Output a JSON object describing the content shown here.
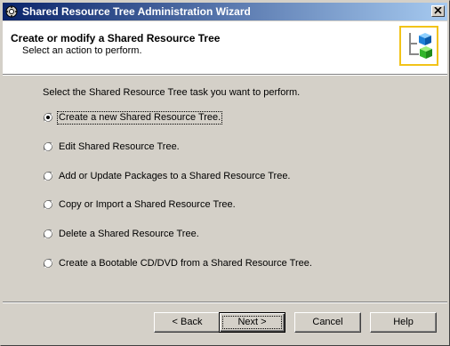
{
  "window": {
    "title": "Shared Resource Tree Administration Wizard",
    "close_label": "x"
  },
  "header": {
    "title": "Create or modify a Shared Resource Tree",
    "subtitle": "Select an action to perform."
  },
  "main": {
    "instruction": "Select the Shared Resource Tree task you want to perform.",
    "selected_option": 0,
    "options": [
      {
        "label": "Create a new Shared Resource Tree."
      },
      {
        "label": "Edit Shared Resource Tree."
      },
      {
        "label": "Add or Update Packages to a Shared Resource Tree."
      },
      {
        "label": "Copy or Import a Shared Resource Tree."
      },
      {
        "label": "Delete a Shared Resource Tree."
      },
      {
        "label": "Create a Bootable CD/DVD from a Shared Resource Tree."
      }
    ]
  },
  "buttons": {
    "back": "< Back",
    "next": "Next >",
    "cancel": "Cancel",
    "help": "Help"
  },
  "colors": {
    "title_gradient_start": "#0a246a",
    "title_gradient_end": "#a6caf0",
    "logo_border": "#f2c318",
    "dialog_face": "#d4d0c8"
  },
  "icons": {
    "title": "wizard-app-icon",
    "logo": "resource-tree-cubes-icon",
    "close": "close-icon"
  }
}
